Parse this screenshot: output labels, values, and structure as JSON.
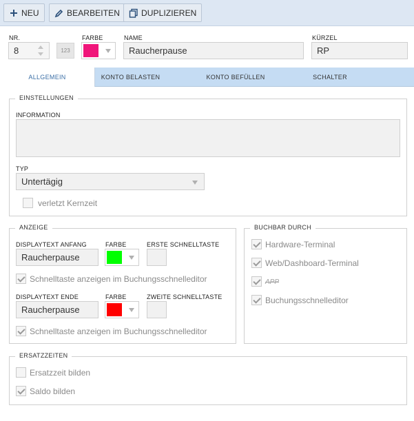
{
  "toolbar": {
    "new_label": "NEU",
    "edit_label": "BEARBEITEN",
    "duplicate_label": "DUPLIZIEREN"
  },
  "header": {
    "nr_label": "NR.",
    "nr_value": "8",
    "numeric_badge": "123",
    "color_label": "FARBE",
    "color_value": "#f0157a",
    "name_label": "NAME",
    "name_value": "Raucherpause",
    "short_label": "KÜRZEL",
    "short_value": "RP"
  },
  "tabs": [
    {
      "label": "ALLGEMEIN",
      "active": true
    },
    {
      "label": "KONTO BELASTEN",
      "active": false
    },
    {
      "label": "KONTO BEFÜLLEN",
      "active": false
    },
    {
      "label": "SCHALTER",
      "active": false
    }
  ],
  "settings": {
    "title": "EINSTELLUNGEN",
    "info_label": "INFORMATION",
    "info_value": "",
    "type_label": "TYP",
    "type_value": "Untertägig",
    "core_time_label": "verletzt Kernzeit",
    "core_time_checked": false
  },
  "display": {
    "title": "ANZEIGE",
    "start_text_label": "DISPLAYTEXT ANFANG",
    "start_text_value": "Raucherpause",
    "start_color_label": "FARBE",
    "start_color": "#00ff00",
    "first_key_label": "ERSTE SCHNELLTASTE",
    "start_show_label": "Schnelltaste anzeigen im Buchungsschnelleditor",
    "end_text_label": "DISPLAYTEXT ENDE",
    "end_text_value": "Raucherpause",
    "end_color_label": "FARBE",
    "end_color": "#ff0000",
    "second_key_label": "ZWEITE SCHNELLTASTE",
    "end_show_label": "Schnelltaste anzeigen im Buchungsschnelleditor"
  },
  "bookable": {
    "title": "BUCHBAR DURCH",
    "items": [
      {
        "label": "Hardware-Terminal",
        "checked": true
      },
      {
        "label": "Web/Dashboard-Terminal",
        "checked": true
      },
      {
        "label": "APP",
        "checked": true
      },
      {
        "label": "Buchungsschnelleditor",
        "checked": true
      }
    ]
  },
  "replacement": {
    "title": "ERSATZZEITEN",
    "form_label": "Ersatzzeit bilden",
    "form_checked": false,
    "balance_label": "Saldo bilden",
    "balance_checked": true
  }
}
